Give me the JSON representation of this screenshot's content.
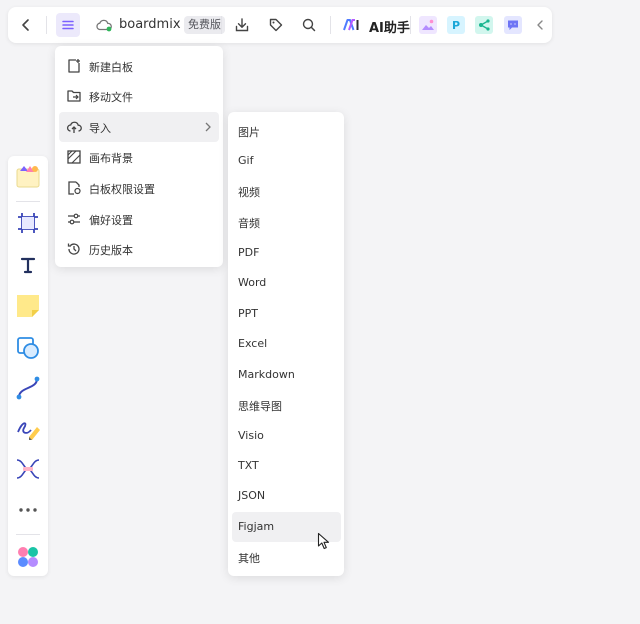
{
  "toolbar": {
    "filename": "boardmix",
    "plan_badge": "免费版",
    "ai_label": "AI助手",
    "icons": [
      "back-icon",
      "menu-icon",
      "cloud-sync-icon",
      "download-icon",
      "tag-icon",
      "search-icon",
      "ai-logo-icon",
      "image-ai-app-icon",
      "p-app-icon",
      "mindmap-app-icon",
      "chat-app-icon",
      "collapse-icon"
    ],
    "colors": {
      "accent": "#7b61ff",
      "menu_active_bg": "#ece9fb",
      "sync_dot": "#2fb55a"
    }
  },
  "main_menu": {
    "items": [
      {
        "label": "新建白板",
        "icon": "new-board-icon"
      },
      {
        "label": "移动文件",
        "icon": "move-file-icon"
      },
      {
        "label": "导入",
        "icon": "upload-cloud-icon",
        "has_submenu": true,
        "active": true
      },
      {
        "label": "画布背景",
        "icon": "canvas-background-icon"
      },
      {
        "label": "白板权限设置",
        "icon": "permission-icon"
      },
      {
        "label": "偏好设置",
        "icon": "preferences-icon"
      },
      {
        "label": "历史版本",
        "icon": "history-icon"
      }
    ]
  },
  "import_menu": {
    "items": [
      "图片",
      "Gif",
      "视频",
      "音频",
      "PDF",
      "Word",
      "PPT",
      "Excel",
      "Markdown",
      "思维导图",
      "Visio",
      "TXT",
      "JSON",
      "Figjam",
      "其他"
    ],
    "hovered": "Figjam"
  },
  "left_toolbar": {
    "tools": [
      "template-icon",
      "frame-icon",
      "text-icon",
      "sticky-note-icon",
      "shape-icon",
      "connector-icon",
      "pen-icon",
      "mindmap-icon",
      "more-icon",
      "apps-icon"
    ]
  }
}
